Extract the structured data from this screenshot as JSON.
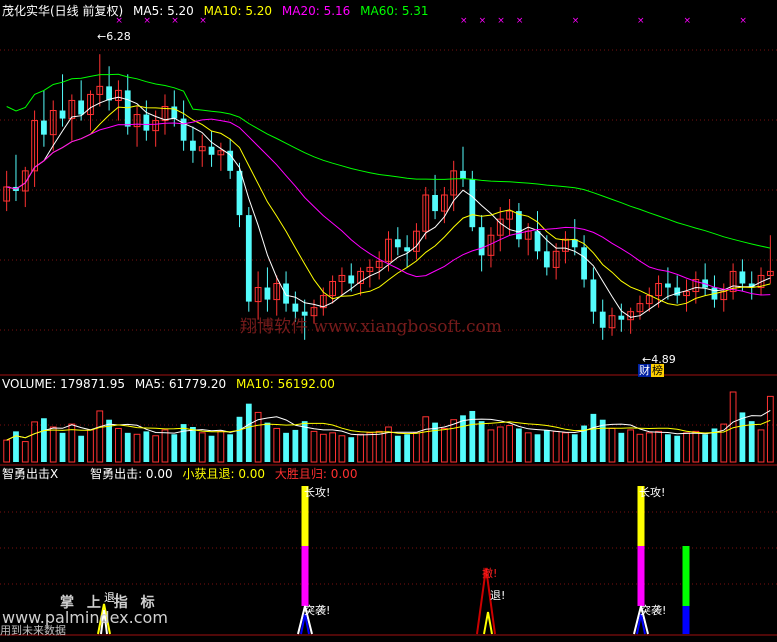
{
  "colors": {
    "ma5": "#ffffff",
    "ma10": "#ffff00",
    "ma20": "#ff00ff",
    "ma60": "#00ff00",
    "up": "#ff3232",
    "down": "#54fcfc",
    "grid": "#7a1010",
    "signal_yellow": "#ffff00",
    "signal_magenta": "#ff00ff",
    "signal_blue": "#0000ff",
    "signal_green": "#00ff00",
    "signal_red": "#cc0000",
    "signal_white": "#ffffff"
  },
  "price_header": {
    "title": "茂化实华(日线 前复权)",
    "ma5": "MA5: 5.20",
    "ma10": "MA10: 5.20",
    "ma20": "MA20: 5.16",
    "ma60": "MA60: 5.31"
  },
  "volume_header": {
    "volume": "VOLUME: 179871.95",
    "ma5": "MA5: 61779.20",
    "ma10": "MA10: 56192.00"
  },
  "indicator_header": {
    "name": "智勇出击X",
    "v1": "智勇出击: 0.00",
    "v2": "小获且退: 0.00",
    "v3": "大胜且归: 0.00"
  },
  "annotations": {
    "high": "6.28",
    "low": "4.89",
    "cai": "财",
    "bang": "榜",
    "watermark": "翔博软件 www.xiangbosoft.com",
    "site": "www.palmindex.com",
    "logo": "掌 上 指 标",
    "logo_sub": "用到未来数据"
  },
  "chart_data": {
    "type": "candlestick",
    "price_range": [
      4.7,
      6.45
    ],
    "candles": [
      [
        5.55,
        5.7,
        5.5,
        5.62
      ],
      [
        5.62,
        5.78,
        5.55,
        5.6
      ],
      [
        5.6,
        5.72,
        5.52,
        5.7
      ],
      [
        5.7,
        6.0,
        5.62,
        5.95
      ],
      [
        5.95,
        6.1,
        5.82,
        5.88
      ],
      [
        5.88,
        6.05,
        5.8,
        6.0
      ],
      [
        6.0,
        6.18,
        5.92,
        5.96
      ],
      [
        5.96,
        6.08,
        5.85,
        6.05
      ],
      [
        6.05,
        6.15,
        5.95,
        5.98
      ],
      [
        5.98,
        6.1,
        5.9,
        6.08
      ],
      [
        6.08,
        6.28,
        6.02,
        6.12
      ],
      [
        6.12,
        6.22,
        6.0,
        6.05
      ],
      [
        6.05,
        6.15,
        5.95,
        6.1
      ],
      [
        6.1,
        6.18,
        5.88,
        5.92
      ],
      [
        5.92,
        6.02,
        5.82,
        5.98
      ],
      [
        5.98,
        6.05,
        5.85,
        5.9
      ],
      [
        5.9,
        6.0,
        5.82,
        5.95
      ],
      [
        5.95,
        6.08,
        5.88,
        6.02
      ],
      [
        6.02,
        6.1,
        5.92,
        5.96
      ],
      [
        5.96,
        6.05,
        5.8,
        5.85
      ],
      [
        5.85,
        5.92,
        5.74,
        5.8
      ],
      [
        5.8,
        5.88,
        5.72,
        5.82
      ],
      [
        5.82,
        5.9,
        5.72,
        5.78
      ],
      [
        5.78,
        5.84,
        5.7,
        5.8
      ],
      [
        5.8,
        5.86,
        5.66,
        5.7
      ],
      [
        5.7,
        5.74,
        5.42,
        5.48
      ],
      [
        5.48,
        5.52,
        5.0,
        5.05
      ],
      [
        5.05,
        5.2,
        4.96,
        5.12
      ],
      [
        5.12,
        5.22,
        5.0,
        5.06
      ],
      [
        5.06,
        5.18,
        4.98,
        5.14
      ],
      [
        5.14,
        5.2,
        5.0,
        5.04
      ],
      [
        5.04,
        5.1,
        4.95,
        5.0
      ],
      [
        5.0,
        5.06,
        4.86,
        4.98
      ],
      [
        4.98,
        5.06,
        4.94,
        5.02
      ],
      [
        5.02,
        5.12,
        4.98,
        5.08
      ],
      [
        5.08,
        5.18,
        5.04,
        5.15
      ],
      [
        5.15,
        5.22,
        5.08,
        5.18
      ],
      [
        5.18,
        5.24,
        5.1,
        5.14
      ],
      [
        5.14,
        5.22,
        5.08,
        5.2
      ],
      [
        5.2,
        5.26,
        5.12,
        5.22
      ],
      [
        5.22,
        5.3,
        5.16,
        5.25
      ],
      [
        5.25,
        5.4,
        5.2,
        5.36
      ],
      [
        5.36,
        5.42,
        5.28,
        5.32
      ],
      [
        5.32,
        5.38,
        5.22,
        5.3
      ],
      [
        5.3,
        5.44,
        5.26,
        5.4
      ],
      [
        5.4,
        5.62,
        5.36,
        5.58
      ],
      [
        5.58,
        5.68,
        5.46,
        5.5
      ],
      [
        5.5,
        5.62,
        5.44,
        5.58
      ],
      [
        5.58,
        5.75,
        5.5,
        5.7
      ],
      [
        5.7,
        5.82,
        5.62,
        5.66
      ],
      [
        5.66,
        5.7,
        5.4,
        5.42
      ],
      [
        5.42,
        5.48,
        5.2,
        5.28
      ],
      [
        5.28,
        5.42,
        5.22,
        5.38
      ],
      [
        5.38,
        5.52,
        5.3,
        5.46
      ],
      [
        5.46,
        5.56,
        5.38,
        5.5
      ],
      [
        5.5,
        5.54,
        5.32,
        5.36
      ],
      [
        5.36,
        5.44,
        5.28,
        5.4
      ],
      [
        5.4,
        5.5,
        5.26,
        5.3
      ],
      [
        5.3,
        5.38,
        5.18,
        5.22
      ],
      [
        5.22,
        5.34,
        5.16,
        5.3
      ],
      [
        5.3,
        5.4,
        5.24,
        5.36
      ],
      [
        5.36,
        5.46,
        5.28,
        5.32
      ],
      [
        5.32,
        5.38,
        5.12,
        5.16
      ],
      [
        5.16,
        5.22,
        4.94,
        5.0
      ],
      [
        5.0,
        5.06,
        4.86,
        4.92
      ],
      [
        4.92,
        5.02,
        4.88,
        4.98
      ],
      [
        4.98,
        5.04,
        4.9,
        4.96
      ],
      [
        4.96,
        5.02,
        4.89,
        5.0
      ],
      [
        5.0,
        5.08,
        4.96,
        5.04
      ],
      [
        5.04,
        5.12,
        5.0,
        5.08
      ],
      [
        5.08,
        5.18,
        5.02,
        5.14
      ],
      [
        5.14,
        5.22,
        5.06,
        5.12
      ],
      [
        5.12,
        5.18,
        5.04,
        5.08
      ],
      [
        5.08,
        5.16,
        5.0,
        5.1
      ],
      [
        5.1,
        5.2,
        5.04,
        5.16
      ],
      [
        5.16,
        5.24,
        5.08,
        5.12
      ],
      [
        5.12,
        5.18,
        5.02,
        5.06
      ],
      [
        5.06,
        5.14,
        5.0,
        5.1
      ],
      [
        5.1,
        5.24,
        5.06,
        5.2
      ],
      [
        5.2,
        5.26,
        5.1,
        5.14
      ],
      [
        5.14,
        5.2,
        5.06,
        5.12
      ],
      [
        5.12,
        5.22,
        5.08,
        5.18
      ],
      [
        5.18,
        5.38,
        5.14,
        5.2
      ]
    ],
    "volume": [
      30,
      42,
      28,
      55,
      60,
      48,
      40,
      52,
      36,
      44,
      70,
      58,
      46,
      40,
      38,
      42,
      36,
      44,
      38,
      52,
      48,
      40,
      36,
      42,
      38,
      62,
      80,
      68,
      54,
      46,
      40,
      44,
      56,
      42,
      38,
      40,
      36,
      34,
      38,
      40,
      42,
      48,
      36,
      38,
      40,
      62,
      54,
      46,
      58,
      64,
      70,
      56,
      44,
      48,
      50,
      46,
      40,
      38,
      44,
      42,
      40,
      38,
      50,
      66,
      58,
      46,
      40,
      44,
      38,
      40,
      42,
      38,
      36,
      40,
      42,
      38,
      46,
      52,
      96,
      68,
      56,
      44,
      90
    ],
    "indicator_signals": [
      {
        "index": 8,
        "stack": []
      },
      {
        "index": 40,
        "stack": [
          "yellow",
          "magenta"
        ]
      },
      {
        "index": 63,
        "stack": []
      },
      {
        "index": 82,
        "stack": [
          "yellow",
          "magenta"
        ]
      },
      {
        "index": 89,
        "stack": [
          "green",
          "blue"
        ]
      }
    ],
    "indicator_labels": [
      "长攻!",
      "突袭!",
      "退!",
      "撤!"
    ]
  }
}
